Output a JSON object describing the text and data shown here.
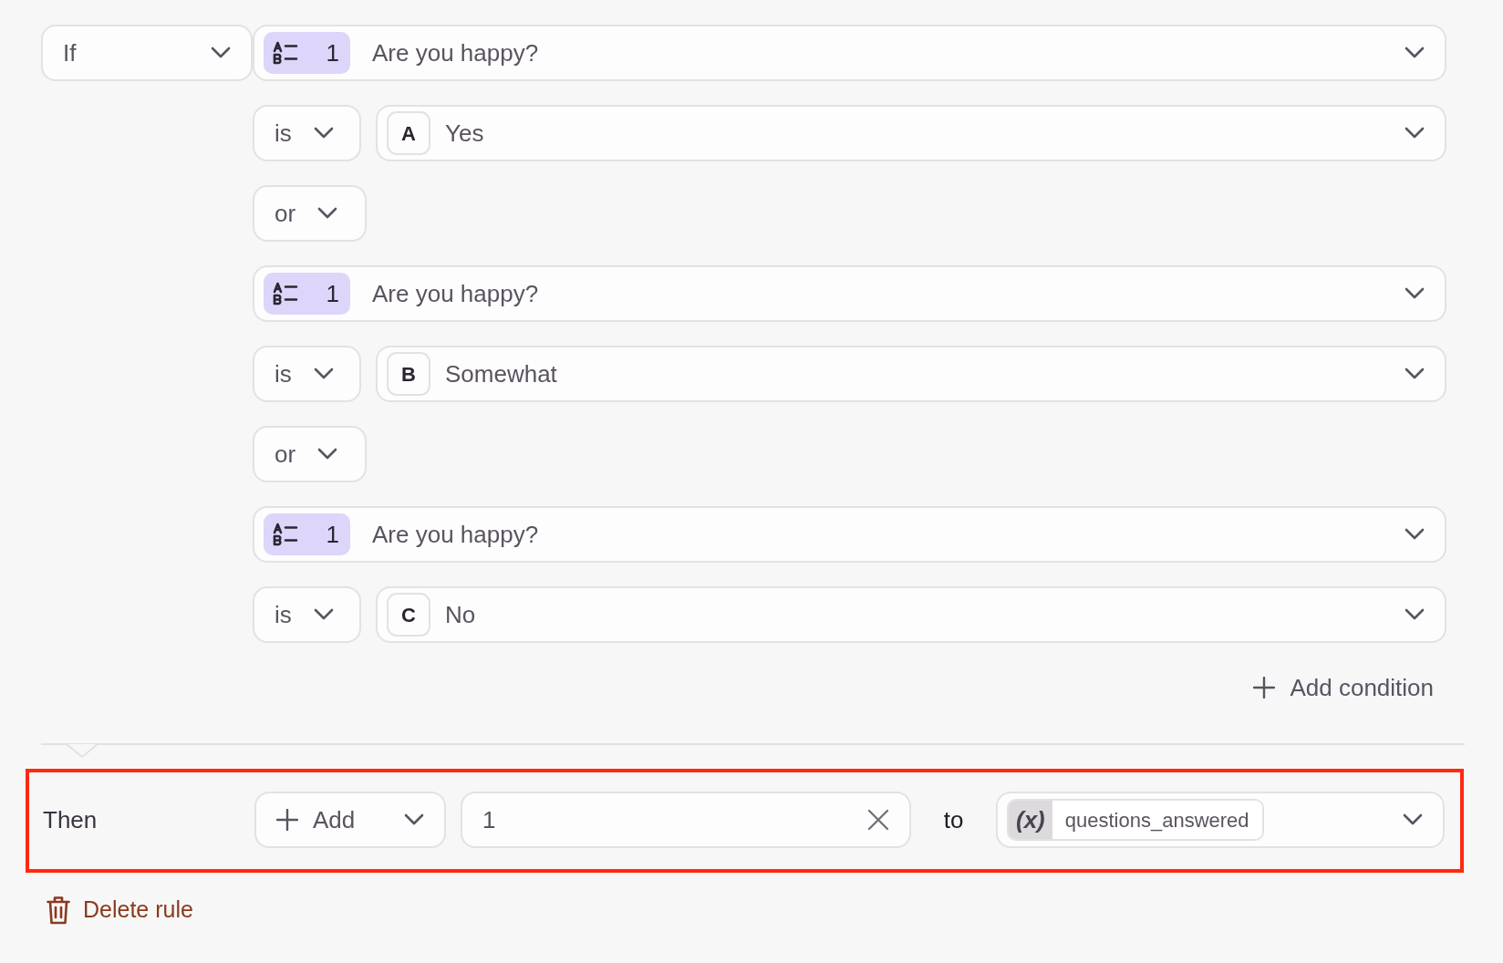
{
  "if_dropdown": {
    "label": "If"
  },
  "conditions": [
    {
      "kind": "question",
      "badge_number": "1",
      "question": "Are you happy?"
    },
    {
      "kind": "answer",
      "operator": "is",
      "letter": "A",
      "answer": "Yes"
    },
    {
      "kind": "connector",
      "label": "or"
    },
    {
      "kind": "question",
      "badge_number": "1",
      "question": "Are you happy?"
    },
    {
      "kind": "answer",
      "operator": "is",
      "letter": "B",
      "answer": "Somewhat"
    },
    {
      "kind": "connector",
      "label": "or"
    },
    {
      "kind": "question",
      "badge_number": "1",
      "question": "Are you happy?"
    },
    {
      "kind": "answer",
      "operator": "is",
      "letter": "C",
      "answer": "No"
    }
  ],
  "add_condition": "Add condition",
  "then": {
    "label": "Then",
    "highlighted": true,
    "action": "Add",
    "value": "1",
    "to": "to",
    "variable_badge": "(x)",
    "variable": "questions_answered"
  },
  "delete_rule": "Delete rule"
}
